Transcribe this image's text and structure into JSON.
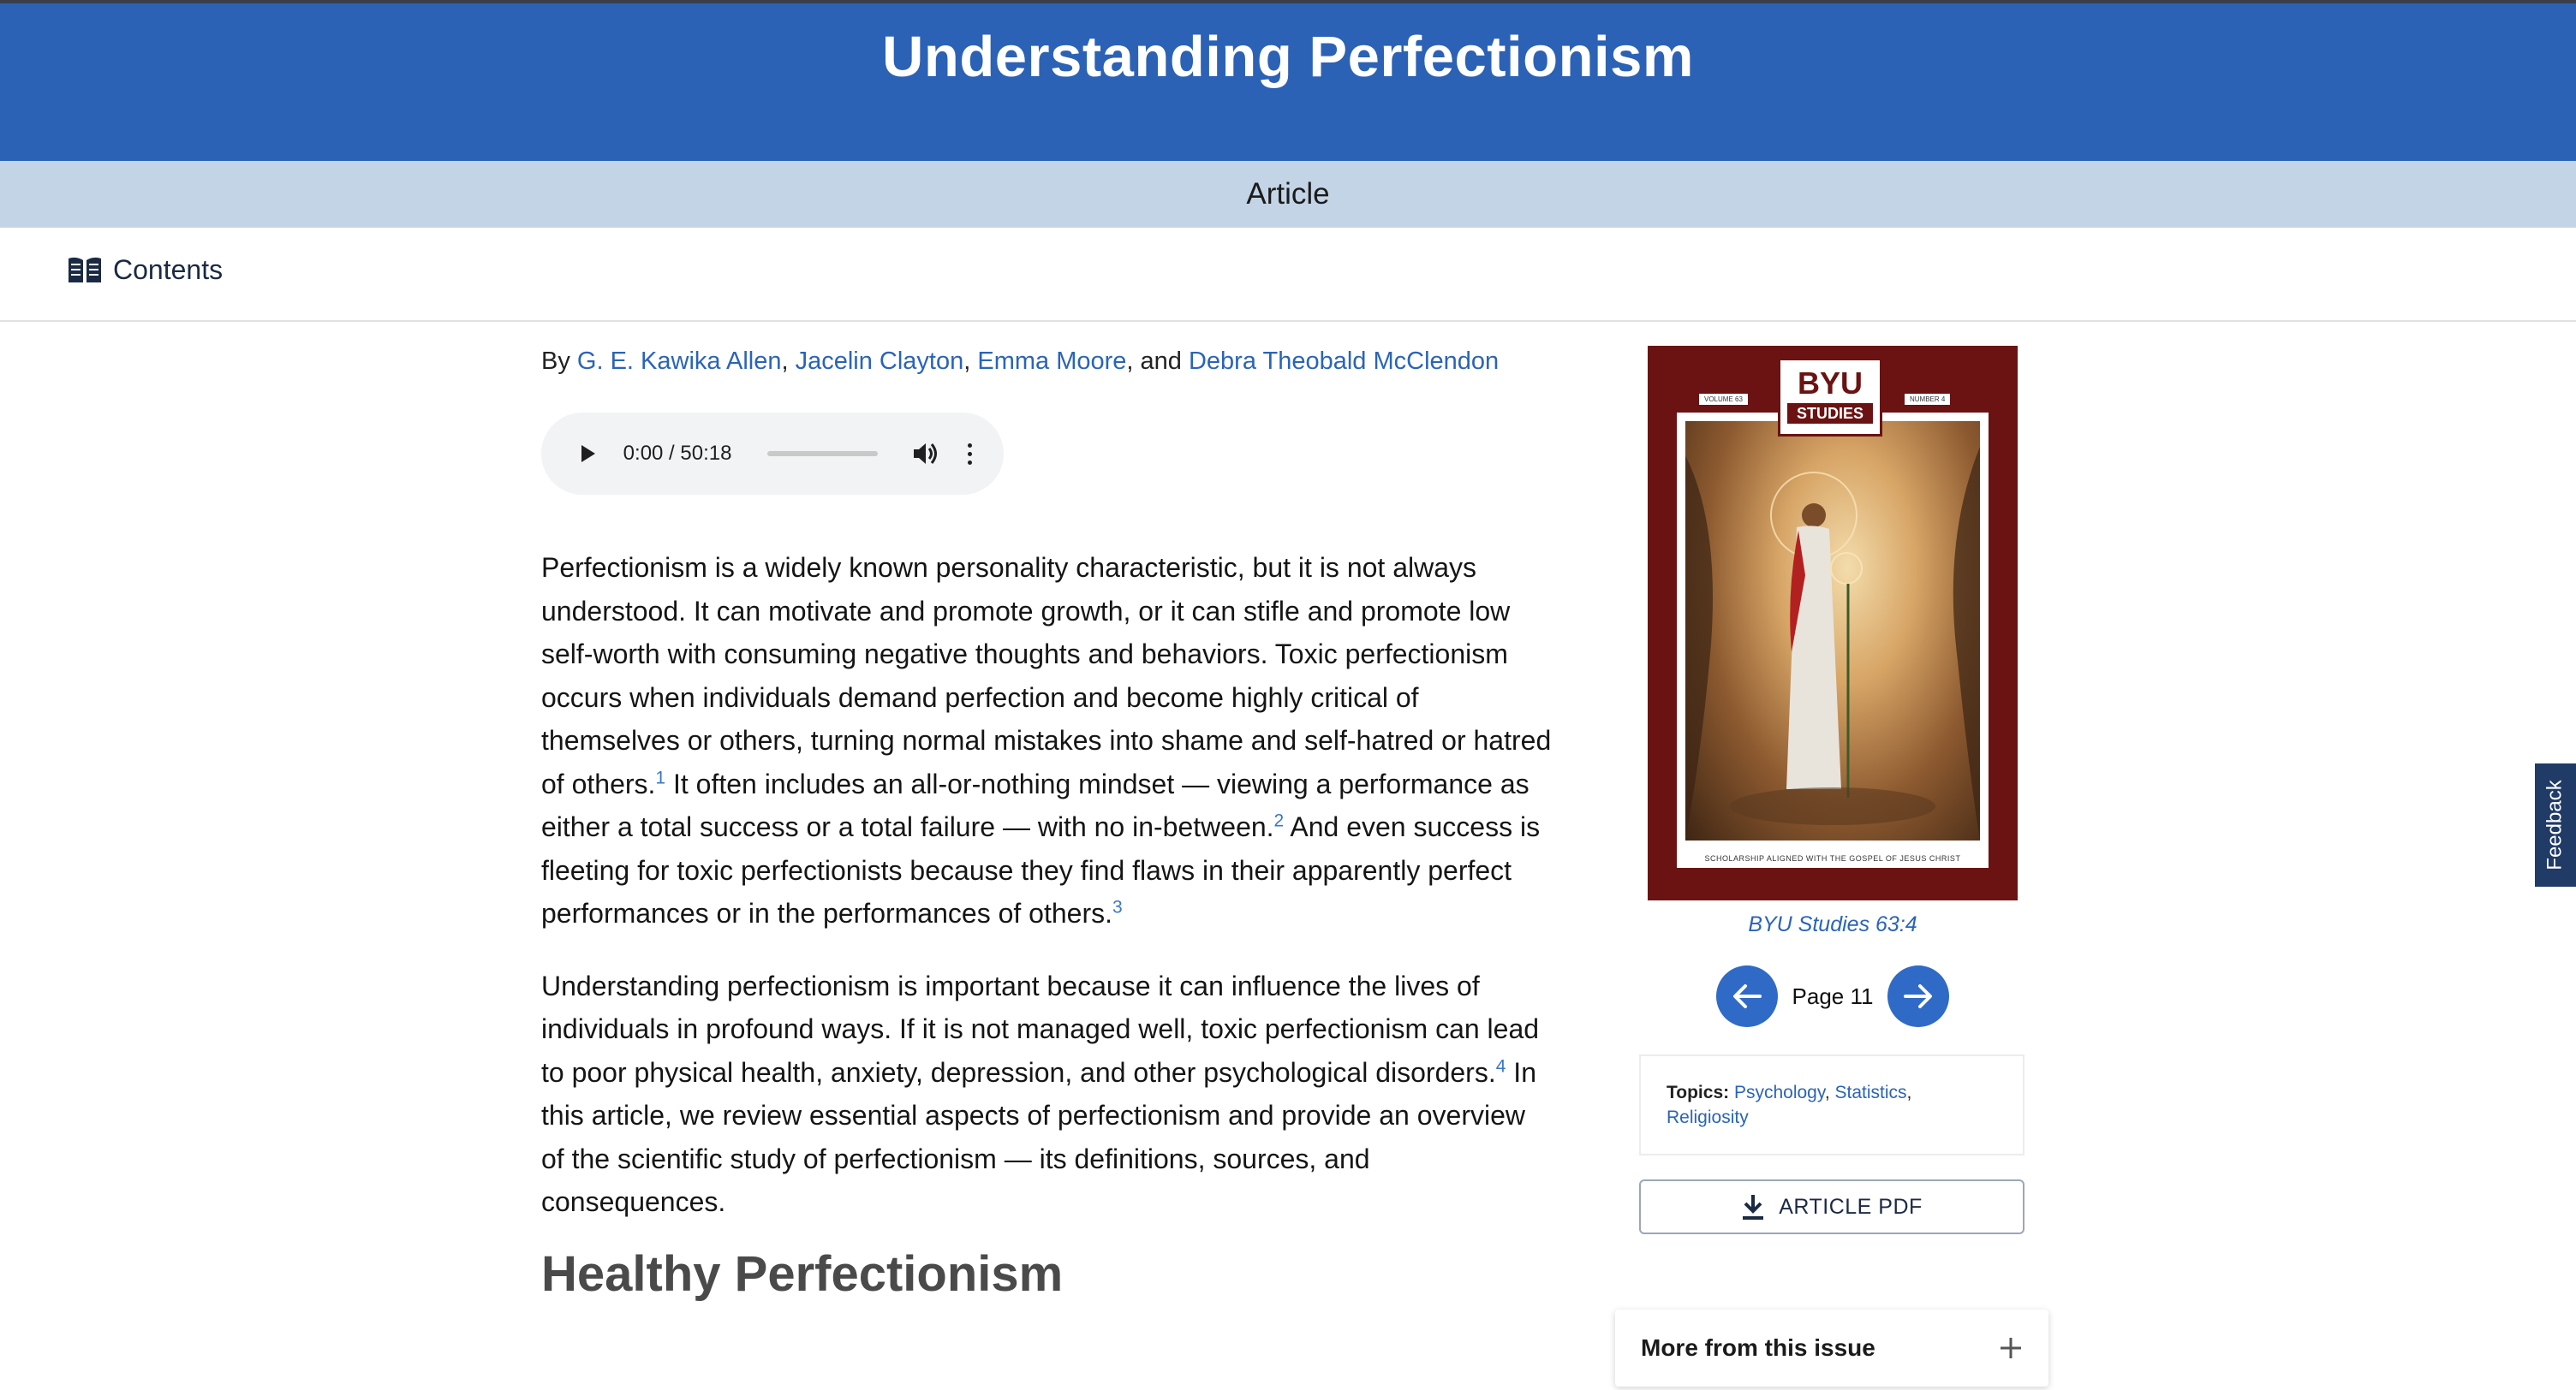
{
  "header": {
    "title": "Understanding Perfectionism"
  },
  "subbar": {
    "label": "Article"
  },
  "nav": {
    "contents_label": "Contents",
    "contents_icon": "open-book-icon"
  },
  "byline": {
    "prefix": "By",
    "authors": [
      "G. E. Kawika Allen",
      "Jacelin Clayton",
      "Emma Moore",
      "Debra Theobald McClendon"
    ],
    "sep1": ",",
    "sep2": ",",
    "sep3": ", and"
  },
  "audio": {
    "time": "0:00 / 50:18",
    "progress": 0
  },
  "article": {
    "p1_a": "Perfectionism is a widely known personality characteristic, but it is not always understood. It can motivate and promote growth, or it can stifle and promote low self-worth with consuming negative thoughts and behaviors. Toxic perfectionism occurs when individuals demand perfection and become highly critical of themselves or others, turning normal mistakes into shame and self-hatred or hatred of others.",
    "fn1": "1",
    "p1_b": " It often includes an all-or-nothing mindset — viewing a performance as either a total success or a total failure — with no in-between.",
    "fn2": "2",
    "p1_c": " And even success is fleeting for toxic perfectionists because they find flaws in their apparently perfect performances or in the performances of others.",
    "fn3": "3",
    "p2_a": "Understanding perfectionism is important because it can influence the lives of individuals in profound ways. If it is not managed well, toxic perfectionism can lead to poor physical health, anxiety, depression, and other psychological disorders.",
    "fn4": "4",
    "p2_b": " In this article, we review essential aspects of perfectionism and provide an overview of the scientific study of perfectionism — its definitions, sources, and consequences.",
    "section_heading": "Healthy Perfectionism"
  },
  "sidebar": {
    "cover": {
      "brand": "BYU",
      "brand_sub": "STUDIES",
      "volume": "VOLUME 63",
      "number": "NUMBER 4",
      "tagline": "SCHOLARSHIP ALIGNED WITH THE GOSPEL OF JESUS CHRIST"
    },
    "issue_link": "BYU Studies 63:4",
    "page_label": "Page 11",
    "topics_label": "Topics:",
    "topics": [
      "Psychology",
      "Statistics",
      "Religiosity"
    ],
    "topics_sep": ",",
    "pdf_label": "ARTICLE PDF",
    "more_label": "More from this issue"
  },
  "feedback": {
    "label": "Feedback"
  },
  "colors": {
    "header": "#2b62b5",
    "subbar": "#c3d4e6",
    "link": "#2a64b8",
    "cover": "#6a1312"
  }
}
